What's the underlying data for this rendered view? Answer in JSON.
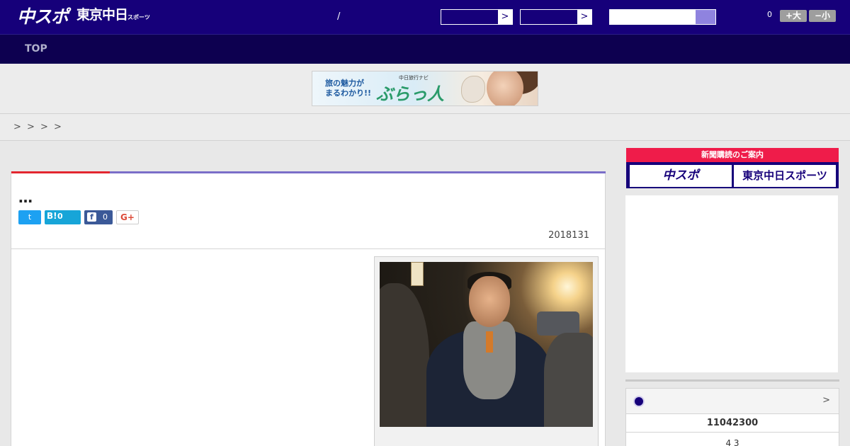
{
  "header": {
    "logo_main": "中スポ",
    "logo_sub": "東京中日",
    "logo_sub_small": "スポーツ",
    "slash": "/",
    "select1_arrow": ">",
    "select2_arrow": ">",
    "count": "0",
    "font_large": "+大",
    "font_small": "−小"
  },
  "nav": {
    "top_label": "TOP"
  },
  "banner": {
    "line1": "旅の魅力が",
    "line2": "まるわかり!!",
    "brand_small": "中日旅行ナビ",
    "brand_big": "ぶらっ人"
  },
  "breadcrumb": [
    ">",
    ">",
    ">",
    ">"
  ],
  "article": {
    "title": "…",
    "twitter_icon": "t",
    "hatena_icon": "B!",
    "hatena_count": "0",
    "facebook_icon": "f",
    "facebook_count": "0",
    "gplus_label": "G+",
    "date": "2018131"
  },
  "sidebar": {
    "subscribe_title": "新聞購読のご案内",
    "btn_chuspo": "中スポ",
    "btn_tokyo": "東京中日スポーツ",
    "baseball_more": ">",
    "score_row1": "11042300",
    "score_row2": "4  3"
  },
  "colors": {
    "header_bg": "#16007a",
    "nav_bg": "#0d0050",
    "accent_red": "#e3262f",
    "accent_purple": "#7a6ec8",
    "subscribe_red": "#ef1c4a"
  }
}
